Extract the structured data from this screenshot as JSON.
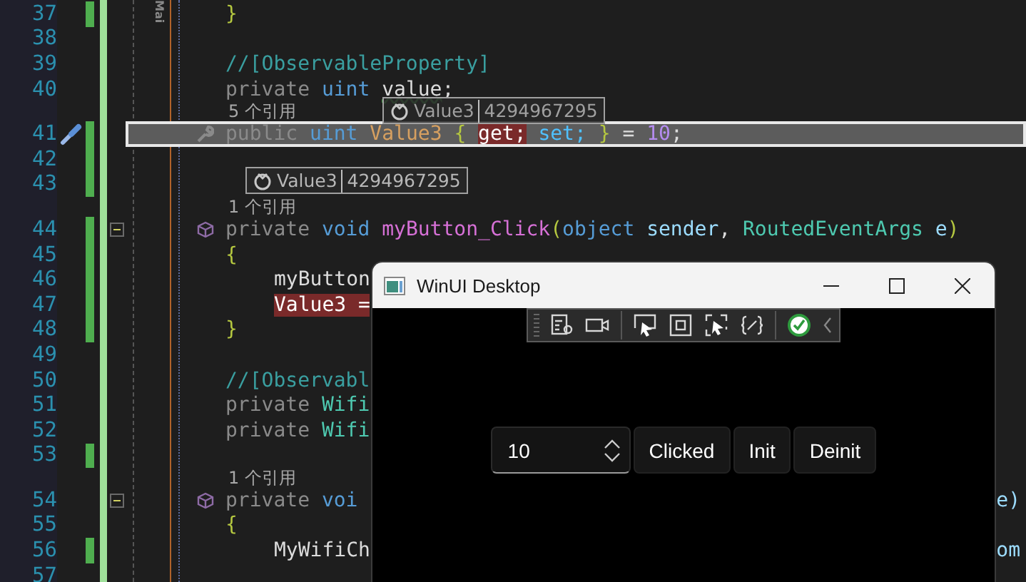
{
  "editor": {
    "side_tab": "Mai",
    "lines": [
      {
        "kind": "code",
        "number": "37",
        "modified": true,
        "current": false,
        "quick_action": false,
        "foldable": false,
        "property_icon": false,
        "method_icon": false,
        "indented": false,
        "tokens": [
          {
            "text": "}",
            "kind": "brace"
          }
        ]
      },
      {
        "kind": "code",
        "number": "38",
        "modified": false,
        "current": false,
        "quick_action": false,
        "foldable": false,
        "property_icon": false,
        "method_icon": false
      },
      {
        "kind": "code",
        "number": "39",
        "modified": false,
        "current": false,
        "quick_action": false,
        "foldable": false,
        "property_icon": false,
        "method_icon": false,
        "indented": false,
        "tokens": [
          {
            "text": "//[ObservableProperty]",
            "kind": "comment"
          }
        ]
      },
      {
        "kind": "code",
        "number": "40",
        "modified": false,
        "current": false,
        "quick_action": false,
        "foldable": false,
        "property_icon": false,
        "method_icon": false,
        "indented": false,
        "tokens": [
          {
            "text": "private ",
            "kind": "access"
          },
          {
            "text": "uint ",
            "kind": "type"
          },
          {
            "text": "value",
            "kind": "warn"
          },
          {
            "text": ";",
            "kind": "punct"
          }
        ]
      },
      {
        "kind": "codelens",
        "text": "5 个引用"
      },
      {
        "kind": "code",
        "number": "41",
        "modified": true,
        "current": true,
        "quick_action": true,
        "foldable": false,
        "property_icon": true,
        "method_icon": false,
        "indented": false,
        "tokens": [
          {
            "text": "public ",
            "kind": "access"
          },
          {
            "text": "uint ",
            "kind": "type"
          },
          {
            "text": "Value3 ",
            "kind": "prop"
          },
          {
            "text": "{ ",
            "kind": "brace"
          },
          {
            "text": "get;",
            "kind": "error"
          },
          {
            "text": " set; ",
            "kind": "accessor"
          },
          {
            "text": "}",
            "kind": "brace"
          },
          {
            "text": " = ",
            "kind": "punct"
          },
          {
            "text": "10",
            "kind": "num"
          },
          {
            "text": ";",
            "kind": "punct"
          }
        ]
      },
      {
        "kind": "code",
        "number": "42",
        "modified": true,
        "current": false,
        "quick_action": false,
        "foldable": false,
        "property_icon": false,
        "method_icon": false
      },
      {
        "kind": "code",
        "number": "43",
        "modified": true,
        "current": false,
        "quick_action": false,
        "foldable": false,
        "property_icon": false,
        "method_icon": false
      },
      {
        "kind": "codelens",
        "text": "1 个引用"
      },
      {
        "kind": "code",
        "number": "44",
        "modified": true,
        "current": false,
        "quick_action": false,
        "foldable": true,
        "property_icon": false,
        "method_icon": true,
        "indented": false,
        "tokens": [
          {
            "text": "private ",
            "kind": "access"
          },
          {
            "text": "void ",
            "kind": "type"
          },
          {
            "text": "myButton_Click",
            "kind": "method"
          },
          {
            "text": "(",
            "kind": "brace"
          },
          {
            "text": "object ",
            "kind": "type"
          },
          {
            "text": "sender",
            "kind": "param"
          },
          {
            "text": ", ",
            "kind": "punct"
          },
          {
            "text": "RoutedEventArgs ",
            "kind": "class"
          },
          {
            "text": "e",
            "kind": "param"
          },
          {
            "text": ")",
            "kind": "brace"
          }
        ]
      },
      {
        "kind": "code",
        "number": "45",
        "modified": true,
        "current": false,
        "quick_action": false,
        "foldable": false,
        "property_icon": false,
        "method_icon": false,
        "indented": false,
        "tokens": [
          {
            "text": "{",
            "kind": "brace"
          }
        ]
      },
      {
        "kind": "code",
        "number": "46",
        "modified": true,
        "current": false,
        "quick_action": false,
        "foldable": false,
        "property_icon": false,
        "method_icon": false,
        "indented": true,
        "tokens": [
          {
            "text": "myButton",
            "kind": "plain"
          }
        ]
      },
      {
        "kind": "code",
        "number": "47",
        "modified": true,
        "current": false,
        "quick_action": false,
        "foldable": false,
        "property_icon": false,
        "method_icon": false,
        "indented": true,
        "tokens": [
          {
            "text": "Value3 =",
            "kind": "error"
          }
        ]
      },
      {
        "kind": "code",
        "number": "48",
        "modified": true,
        "current": false,
        "quick_action": false,
        "foldable": false,
        "property_icon": false,
        "method_icon": false,
        "indented": false,
        "tokens": [
          {
            "text": "}",
            "kind": "brace"
          }
        ]
      },
      {
        "kind": "code",
        "number": "49",
        "modified": false,
        "current": false,
        "quick_action": false,
        "foldable": false,
        "property_icon": false,
        "method_icon": false
      },
      {
        "kind": "code",
        "number": "50",
        "modified": false,
        "current": false,
        "quick_action": false,
        "foldable": false,
        "property_icon": false,
        "method_icon": false,
        "indented": false,
        "tokens": [
          {
            "text": "//[Observabl",
            "kind": "comment"
          }
        ]
      },
      {
        "kind": "code",
        "number": "51",
        "modified": false,
        "current": false,
        "quick_action": false,
        "foldable": false,
        "property_icon": false,
        "method_icon": false,
        "indented": false,
        "tokens": [
          {
            "text": "private ",
            "kind": "access"
          },
          {
            "text": "Wifi",
            "kind": "class"
          }
        ]
      },
      {
        "kind": "code",
        "number": "52",
        "modified": false,
        "current": false,
        "quick_action": false,
        "foldable": false,
        "property_icon": false,
        "method_icon": false,
        "indented": false,
        "tokens": [
          {
            "text": "private ",
            "kind": "access"
          },
          {
            "text": "Wifi",
            "kind": "class"
          }
        ]
      },
      {
        "kind": "code",
        "number": "53",
        "modified": true,
        "current": false,
        "quick_action": false,
        "foldable": false,
        "property_icon": false,
        "method_icon": false
      },
      {
        "kind": "codelens",
        "text": "1 个引用"
      },
      {
        "kind": "code",
        "number": "54",
        "modified": false,
        "current": false,
        "quick_action": false,
        "foldable": true,
        "property_icon": false,
        "method_icon": true,
        "indented": false,
        "tokens": [
          {
            "text": "private ",
            "kind": "access"
          },
          {
            "text": "voi",
            "kind": "type"
          }
        ],
        "tail": "e)"
      },
      {
        "kind": "code",
        "number": "55",
        "modified": false,
        "current": false,
        "quick_action": false,
        "foldable": false,
        "property_icon": false,
        "method_icon": false,
        "indented": false,
        "tokens": [
          {
            "text": "{",
            "kind": "brace"
          }
        ]
      },
      {
        "kind": "code",
        "number": "56",
        "modified": true,
        "current": false,
        "quick_action": false,
        "foldable": false,
        "property_icon": false,
        "method_icon": false,
        "indented": true,
        "tokens": [
          {
            "text": "MyWifiCh",
            "kind": "plain"
          }
        ],
        "tail": "om"
      },
      {
        "kind": "code",
        "number": "57",
        "modified": false,
        "current": false,
        "quick_action": false,
        "foldable": false,
        "property_icon": false,
        "method_icon": false
      }
    ]
  },
  "datatips": [
    {
      "name": "Value3",
      "value": "4294967295"
    },
    {
      "name": "Value3",
      "value": "4294967295"
    }
  ],
  "app_window": {
    "title": "WinUI Desktop",
    "number_box": {
      "value": "10"
    },
    "buttons": [
      "Clicked",
      "Init",
      "Deinit"
    ]
  }
}
